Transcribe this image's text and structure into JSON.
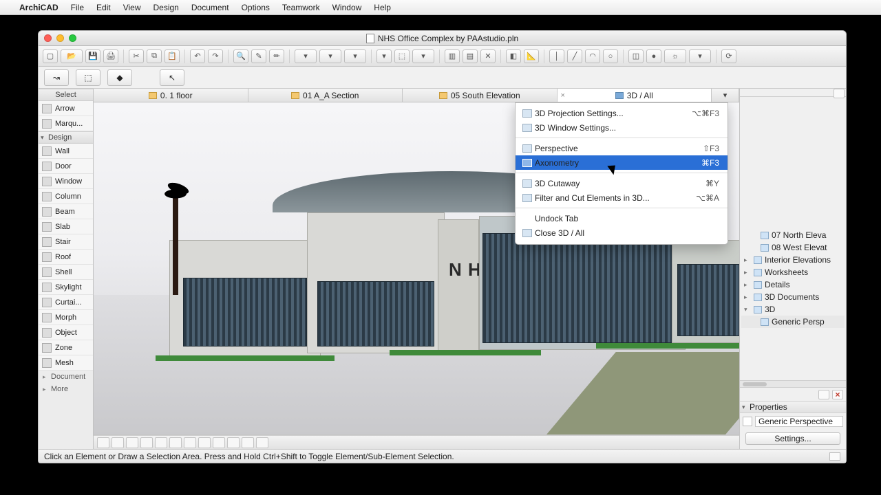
{
  "menubar": {
    "app": "ArchiCAD",
    "items": [
      "File",
      "Edit",
      "View",
      "Design",
      "Document",
      "Options",
      "Teamwork",
      "Window",
      "Help"
    ]
  },
  "window": {
    "title": "NHS Office Complex by PAAstudio.pln"
  },
  "toolbox": {
    "header": "Select",
    "select_tools": [
      {
        "label": "Arrow"
      },
      {
        "label": "Marqu..."
      }
    ],
    "design_group": "Design",
    "design_tools": [
      {
        "label": "Wall"
      },
      {
        "label": "Door"
      },
      {
        "label": "Window"
      },
      {
        "label": "Column"
      },
      {
        "label": "Beam"
      },
      {
        "label": "Slab"
      },
      {
        "label": "Stair"
      },
      {
        "label": "Roof"
      },
      {
        "label": "Shell"
      },
      {
        "label": "Skylight"
      },
      {
        "label": "Curtai..."
      },
      {
        "label": "Morph"
      },
      {
        "label": "Object"
      },
      {
        "label": "Zone"
      },
      {
        "label": "Mesh"
      }
    ],
    "subgroups": [
      "Document",
      "More"
    ]
  },
  "tabs": [
    {
      "label": "0. 1 floor"
    },
    {
      "label": "01 A_A Section"
    },
    {
      "label": "05 South Elevation"
    },
    {
      "label": "3D / All",
      "active": true,
      "closable": true
    }
  ],
  "context_menu": {
    "items": [
      {
        "label": "3D Projection Settings...",
        "shortcut": "⌥⌘F3",
        "icon": true
      },
      {
        "label": "3D Window Settings...",
        "icon": true
      },
      {
        "sep": true
      },
      {
        "label": "Perspective",
        "shortcut": "⇧F3",
        "icon": true,
        "checked": true
      },
      {
        "label": "Axonometry",
        "shortcut": "⌘F3",
        "icon": true,
        "highlight": true
      },
      {
        "sep": true
      },
      {
        "label": "3D Cutaway",
        "shortcut": "⌘Y",
        "icon": true
      },
      {
        "label": "Filter and Cut Elements in 3D...",
        "shortcut": "⌥⌘A",
        "icon": true
      },
      {
        "sep": true
      },
      {
        "label": "Undock Tab"
      },
      {
        "label": "Close 3D / All",
        "icon": true
      }
    ]
  },
  "navigator": {
    "visible_items": [
      {
        "label": "07 North Eleva",
        "leaf": true
      },
      {
        "label": "08 West Elevat",
        "leaf": true
      },
      {
        "label": "Interior Elevations"
      },
      {
        "label": "Worksheets"
      },
      {
        "label": "Details"
      },
      {
        "label": "3D Documents"
      },
      {
        "label": "3D",
        "open": true
      },
      {
        "label": "Generic Persp",
        "leaf": true,
        "selected": true
      }
    ],
    "properties_header": "Properties",
    "properties_value": "Generic Perspective",
    "settings_button": "Settings..."
  },
  "statusbar": {
    "text": "Click an Element or Draw a Selection Area. Press and Hold Ctrl+Shift to Toggle Element/Sub-Element Selection."
  },
  "viewport": {
    "sign": "N\nH\nS"
  }
}
